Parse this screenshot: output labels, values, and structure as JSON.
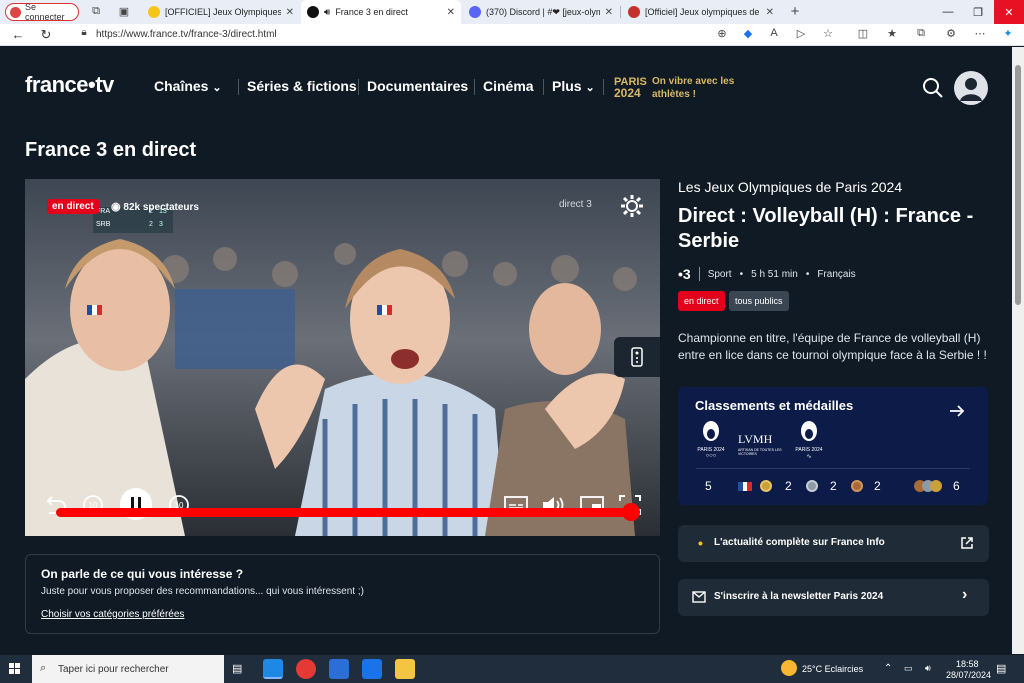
{
  "browser": {
    "profile_label": "Se connecter",
    "tabs": [
      {
        "label": "[OFFICIEL] Jeux Olympiques PAR..."
      },
      {
        "label": "France 3 en direct"
      },
      {
        "label": "(370) Discord | #❤ [jeux-olymp..."
      },
      {
        "label": "[Officiel] Jeux olympiques de Par..."
      }
    ],
    "url": "https://www.france.tv/france-3/direct.html"
  },
  "header": {
    "logo": "france•tv",
    "nav": [
      "Chaînes",
      "Séries & fictions",
      "Documentaires",
      "Cinéma",
      "Plus"
    ],
    "paris_logo_line1": "PARIS",
    "paris_logo_line2": "2024",
    "paris_tagline_1": "On vibre avec les",
    "paris_tagline_2": "athlètes !"
  },
  "page_title": "France 3 en direct",
  "player": {
    "live_badge": "en direct",
    "viewers": "82k spectateurs",
    "channel_bug": "direct 3",
    "score_rows": [
      {
        "team": "FRA",
        "sets": "2",
        "points": "13"
      },
      {
        "team": "SRB",
        "sets": "2",
        "points": "3"
      }
    ],
    "progress": 1.0
  },
  "program": {
    "category": "Les Jeux Olympiques de Paris 2024",
    "title": "Direct : Volleyball (H) : France - Serbie",
    "channel": "•3",
    "genre": "Sport",
    "duration": "5 h 51 min",
    "language": "Français",
    "badge_live": "en direct",
    "badge_audience": "tous publics",
    "description": "Championne en titre, l'équipe de France de volleyball (H) entre en lice dans ce tournoi olympique face à la Serbie ! !"
  },
  "medals": {
    "title": "Classements et médailles",
    "sponsor": "LVMH",
    "sponsor_sub": "ARTISAN DE TOUTES LES VICTOIRES",
    "logo_left": "PARIS 2024",
    "logo_right": "PARIS 2024",
    "rank": "5",
    "gold": "2",
    "silver": "2",
    "bronze": "2",
    "total": "6"
  },
  "links": {
    "france_info": "L'actualité complète sur France Info",
    "newsletter": "S'inscrire à la newsletter Paris 2024"
  },
  "interest": {
    "heading": "On parle de ce qui vous intéresse ?",
    "text": "Juste pour vous proposer des recommandations... qui vous intéressent ;)",
    "link": "Choisir vos catégories préférées"
  },
  "taskbar": {
    "search_placeholder": "Taper ici pour rechercher",
    "weather": "25°C  Eclaircies",
    "time": "18:58",
    "date": "28/07/2024"
  },
  "colors": {
    "page_bg": "#0f1a24",
    "accent_red": "#e4001b",
    "paris_gold": "#d8b866",
    "medal_card": "#0d1b48"
  }
}
